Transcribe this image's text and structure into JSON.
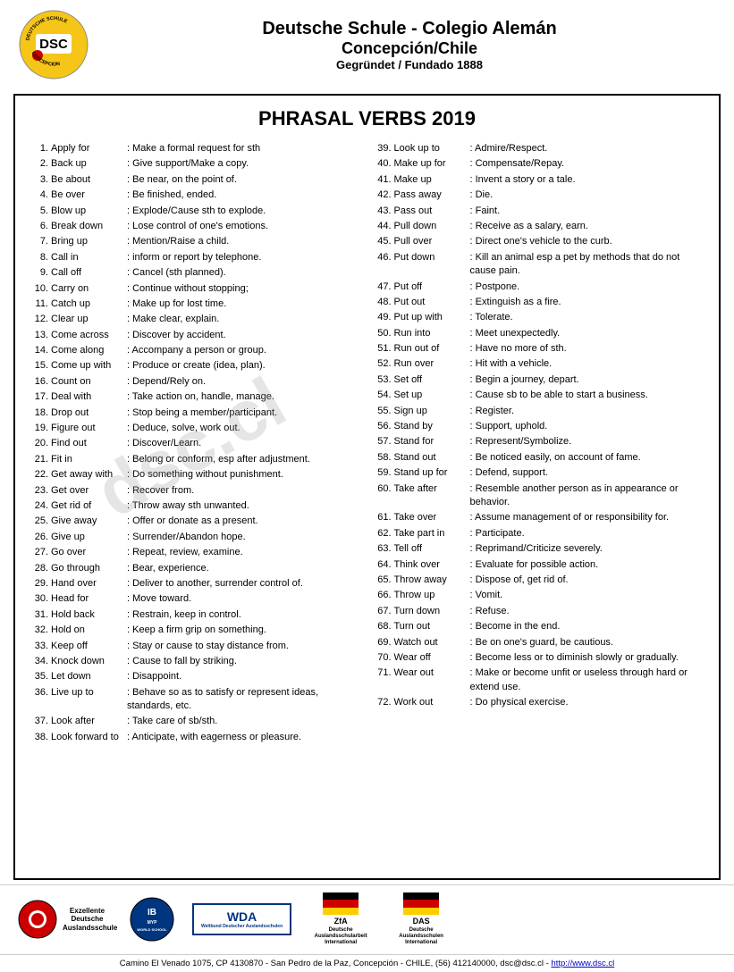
{
  "header": {
    "school_line1": "Deutsche Schule - Colegio Alemán",
    "school_line2": "Concepción/Chile",
    "school_line3": "Gegründet / Fundado 1888"
  },
  "title": "PHRASAL VERBS 2019",
  "left_column": [
    {
      "num": "1.",
      "phrase": "Apply for",
      "def": ": Make a formal request for sth"
    },
    {
      "num": "2.",
      "phrase": "Back up",
      "def": ": Give support/Make a copy."
    },
    {
      "num": "3.",
      "phrase": "Be about",
      "def": ": Be near, on the point of."
    },
    {
      "num": "4.",
      "phrase": "Be over",
      "def": ": Be finished, ended."
    },
    {
      "num": "5.",
      "phrase": "Blow up",
      "def": ": Explode/Cause sth to explode."
    },
    {
      "num": "6.",
      "phrase": "Break down",
      "def": ": Lose control of one's emotions."
    },
    {
      "num": "7.",
      "phrase": "Bring up",
      "def": ": Mention/Raise a child."
    },
    {
      "num": "8.",
      "phrase": "Call in",
      "def": ": inform or report by telephone."
    },
    {
      "num": "9.",
      "phrase": "Call off",
      "def": ": Cancel (sth planned)."
    },
    {
      "num": "10.",
      "phrase": "Carry on",
      "def": ": Continue without stopping;"
    },
    {
      "num": "11.",
      "phrase": "Catch up",
      "def": ": Make up for lost time."
    },
    {
      "num": "12.",
      "phrase": "Clear up",
      "def": ": Make clear, explain."
    },
    {
      "num": "13.",
      "phrase": "Come across",
      "def": ": Discover by accident."
    },
    {
      "num": "14.",
      "phrase": "Come along",
      "def": ": Accompany a person or group."
    },
    {
      "num": "15.",
      "phrase": "Come up with",
      "def": ": Produce or create (idea, plan)."
    },
    {
      "num": "16.",
      "phrase": "Count on",
      "def": ": Depend/Rely on."
    },
    {
      "num": "17.",
      "phrase": "Deal with",
      "def": ": Take action on, handle, manage."
    },
    {
      "num": "18.",
      "phrase": "Drop out",
      "def": ": Stop being a member/participant."
    },
    {
      "num": "19.",
      "phrase": "Figure out",
      "def": ": Deduce, solve, work out."
    },
    {
      "num": "20.",
      "phrase": "Find out",
      "def": ": Discover/Learn."
    },
    {
      "num": "21.",
      "phrase": "Fit in",
      "def": ": Belong or conform, esp after adjustment."
    },
    {
      "num": "22.",
      "phrase": "Get away with",
      "def": ": Do something without punishment."
    },
    {
      "num": "23.",
      "phrase": "Get over",
      "def": ": Recover from."
    },
    {
      "num": "24.",
      "phrase": "Get rid of",
      "def": ": Throw away sth unwanted."
    },
    {
      "num": "25.",
      "phrase": "Give away",
      "def": ": Offer or donate as a present."
    },
    {
      "num": "26.",
      "phrase": "Give up",
      "def": ": Surrender/Abandon hope."
    },
    {
      "num": "27.",
      "phrase": "Go over",
      "def": ": Repeat, review, examine."
    },
    {
      "num": "28.",
      "phrase": "Go through",
      "def": ": Bear, experience."
    },
    {
      "num": "29.",
      "phrase": "Hand over",
      "def": ": Deliver to another, surrender control of."
    },
    {
      "num": "30.",
      "phrase": "Head for",
      "def": ": Move toward."
    },
    {
      "num": "31.",
      "phrase": "Hold back",
      "def": ": Restrain, keep in control."
    },
    {
      "num": "32.",
      "phrase": "Hold on",
      "def": ": Keep a firm grip on something."
    },
    {
      "num": "33.",
      "phrase": "Keep off",
      "def": ": Stay or cause to stay distance from."
    },
    {
      "num": "34.",
      "phrase": "Knock down",
      "def": ": Cause to fall by striking."
    },
    {
      "num": "35.",
      "phrase": "Let down",
      "def": ": Disappoint."
    },
    {
      "num": "36.",
      "phrase": "Live up to",
      "def": ": Behave so as to satisfy or represent ideas, standards, etc."
    },
    {
      "num": "37.",
      "phrase": "Look after",
      "def": ": Take care of sb/sth."
    },
    {
      "num": "38.",
      "phrase": "Look forward to",
      "def": ": Anticipate, with eagerness or pleasure."
    }
  ],
  "right_column": [
    {
      "num": "39.",
      "phrase": "Look up to",
      "def": ": Admire/Respect."
    },
    {
      "num": "40.",
      "phrase": "Make up for",
      "def": ": Compensate/Repay."
    },
    {
      "num": "41.",
      "phrase": "Make up",
      "def": ": Invent a story or a tale."
    },
    {
      "num": "42.",
      "phrase": "Pass away",
      "def": ": Die."
    },
    {
      "num": "43.",
      "phrase": "Pass out",
      "def": ": Faint."
    },
    {
      "num": "44.",
      "phrase": "Pull down",
      "def": ": Receive as a salary, earn."
    },
    {
      "num": "45.",
      "phrase": "Pull over",
      "def": ": Direct one's vehicle to the curb."
    },
    {
      "num": "46.",
      "phrase": "Put down",
      "def": ": Kill an animal esp a pet by methods that do not cause pain."
    },
    {
      "num": "47.",
      "phrase": "Put off",
      "def": ": Postpone."
    },
    {
      "num": "48.",
      "phrase": "Put out",
      "def": ": Extinguish as a fire."
    },
    {
      "num": "49.",
      "phrase": "Put up with",
      "def": ": Tolerate."
    },
    {
      "num": "50.",
      "phrase": "Run into",
      "def": ": Meet unexpectedly."
    },
    {
      "num": "51.",
      "phrase": "Run out of",
      "def": ": Have no more of sth."
    },
    {
      "num": "52.",
      "phrase": "Run over",
      "def": ": Hit with a vehicle."
    },
    {
      "num": "53.",
      "phrase": "Set off",
      "def": ": Begin a journey, depart."
    },
    {
      "num": "54.",
      "phrase": "Set up",
      "def": ": Cause sb to be able to start a business."
    },
    {
      "num": "55.",
      "phrase": "Sign up",
      "def": ": Register."
    },
    {
      "num": "56.",
      "phrase": "Stand by",
      "def": ": Support, uphold."
    },
    {
      "num": "57.",
      "phrase": "Stand for",
      "def": ": Represent/Symbolize."
    },
    {
      "num": "58.",
      "phrase": "Stand out",
      "def": ": Be noticed easily, on account of fame."
    },
    {
      "num": "59.",
      "phrase": "Stand up for",
      "def": ": Defend, support."
    },
    {
      "num": "60.",
      "phrase": "Take after",
      "def": ": Resemble another person as in appearance or behavior."
    },
    {
      "num": "61.",
      "phrase": "Take over",
      "def": ": Assume management of or responsibility for."
    },
    {
      "num": "62.",
      "phrase": "Take part in",
      "def": ": Participate."
    },
    {
      "num": "63.",
      "phrase": "Tell off",
      "def": ": Reprimand/Criticize severely."
    },
    {
      "num": "64.",
      "phrase": "Think over",
      "def": ": Evaluate for possible action."
    },
    {
      "num": "65.",
      "phrase": "Throw away",
      "def": ": Dispose of, get rid of."
    },
    {
      "num": "66.",
      "phrase": "Throw up",
      "def": ": Vomit."
    },
    {
      "num": "67.",
      "phrase": "Turn down",
      "def": ": Refuse."
    },
    {
      "num": "68.",
      "phrase": "Turn out",
      "def": ": Become in the end."
    },
    {
      "num": "69.",
      "phrase": "Watch out",
      "def": ": Be on one's guard, be cautious."
    },
    {
      "num": "70.",
      "phrase": "Wear off",
      "def": ": Become less or to diminish slowly or gradually."
    },
    {
      "num": "71.",
      "phrase": "Wear out",
      "def": ": Make or become unfit or useless through hard or extend use."
    },
    {
      "num": "72.",
      "phrase": "Work out",
      "def": ": Do physical exercise."
    }
  ],
  "footer": {
    "logos": [
      {
        "name": "Exzellente Deutsche Auslandsschule"
      },
      {
        "name": "IB"
      },
      {
        "name": "WDA"
      },
      {
        "name": "ZfA Deutsche Auslandsschularbeit International"
      },
      {
        "name": "DAS Deutsche Auslandsschulen International"
      }
    ],
    "address": "Camino El Venado 1075, CP 4130870 - San Pedro de la Paz, Concepción - CHILE, (56) 412140000, dsc@dsc.cl - http://www.dsc.cl"
  }
}
